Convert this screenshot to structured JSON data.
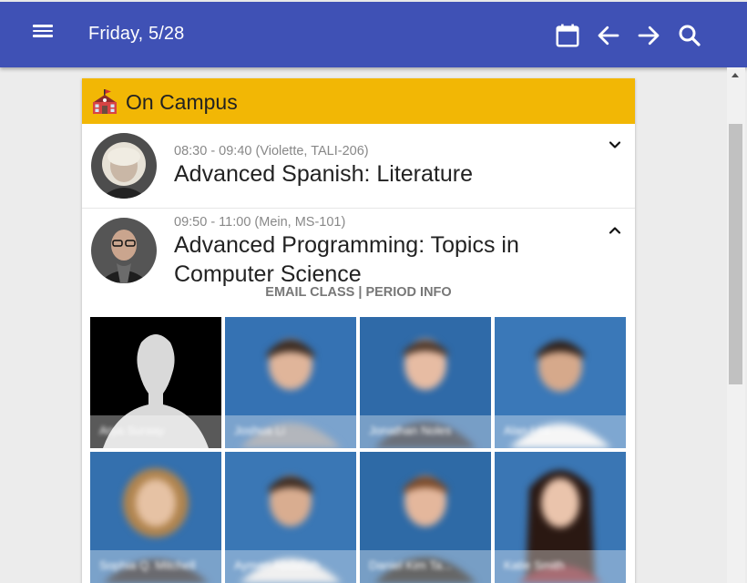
{
  "appbar": {
    "title": "Friday, 5/28",
    "icons": [
      "menu-icon",
      "calendar-icon",
      "arrow-left-icon",
      "arrow-right-icon",
      "search-icon"
    ]
  },
  "section": {
    "label": "On Campus",
    "icon": "school-icon",
    "color": "#f2b705"
  },
  "classes": [
    {
      "time": "08:30 - 09:40 (Violette, TALI-206)",
      "name": "Advanced Spanish: Literature",
      "expanded": false
    },
    {
      "time": "09:50 - 11:00 (Mein, MS-101)",
      "name_line1": "Advanced Programming: Topics in",
      "name_line2": "Computer Science",
      "expanded": true,
      "actions": {
        "email": "EMAIL CLASS",
        "separator": "|",
        "period": "PERIOD INFO"
      },
      "students": [
        {
          "name": "Arya Suraay",
          "photo": "placeholder"
        },
        {
          "name": "Joshua Li",
          "photo": "photo"
        },
        {
          "name": "Jonathan Noles",
          "photo": "photo"
        },
        {
          "name": "Alan Lee",
          "photo": "photo"
        },
        {
          "name": "Sophia Q. Mitchell",
          "photo": "photo"
        },
        {
          "name": "Ayman Abdallah",
          "photo": "photo"
        },
        {
          "name": "Daniel Kim Ta...",
          "photo": "photo"
        },
        {
          "name": "Katie Smith",
          "photo": "photo"
        }
      ]
    }
  ],
  "colors": {
    "appbar": "#3f51b5",
    "photo_backdrop": "#2f6fb0"
  }
}
